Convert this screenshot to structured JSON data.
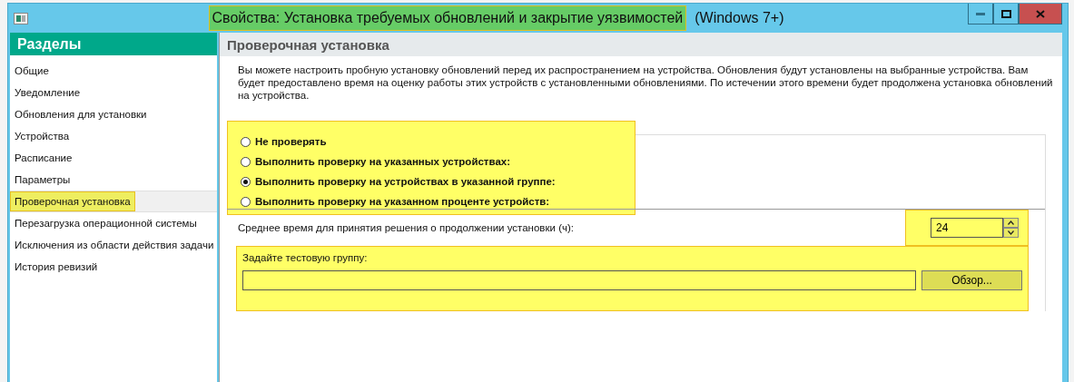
{
  "window": {
    "title_parts": [
      {
        "text": "Свойства: Установка требуемых обновлений и закрытие уязвимостей",
        "highlighted": true
      },
      {
        "text": "(Windows 7+)",
        "highlighted": false
      }
    ]
  },
  "sidebar": {
    "title": "Разделы",
    "items": [
      {
        "label": "Общие",
        "selected": false
      },
      {
        "label": "Уведомление",
        "selected": false
      },
      {
        "label": "Обновления для установки",
        "selected": false
      },
      {
        "label": "Устройства",
        "selected": false
      },
      {
        "label": "Расписание",
        "selected": false
      },
      {
        "label": "Параметры",
        "selected": false
      },
      {
        "label": "Проверочная установка",
        "selected": true
      },
      {
        "label": "Перезагрузка операционной системы",
        "selected": false
      },
      {
        "label": "Исключения из области действия задачи",
        "selected": false
      },
      {
        "label": "История ревизий",
        "selected": false
      }
    ]
  },
  "panel": {
    "title": "Проверочная установка",
    "description": "Вы можете настроить пробную установку обновлений перед их распространением на устройства. Обновления будут установлены на выбранные устройства. Вам будет предоставлено время на оценку работы этих устройств с установленными обновлениями. По истечении этого времени будет продолжена установка обновлений на устройства.",
    "radio_options": [
      {
        "label": "Не проверять",
        "selected": false
      },
      {
        "label": "Выполнить проверку на указанных устройствах:",
        "selected": false
      },
      {
        "label": "Выполнить проверку на устройствах в указанной группе:",
        "selected": true
      },
      {
        "label": "Выполнить проверку на указанном проценте устройств:",
        "selected": false
      }
    ],
    "radio_highlighted": true,
    "hours": {
      "label": "Среднее время для принятия решения о продолжении установки (ч):",
      "value": "24",
      "highlighted": true
    },
    "test_group": {
      "label": "Задайте тестовую группу:",
      "browse_button": "Обзор...",
      "highlighted": true
    }
  }
}
